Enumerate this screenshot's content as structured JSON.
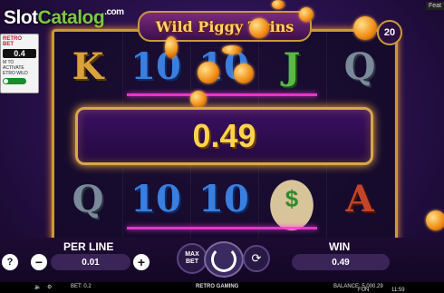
{
  "watermark": {
    "slot": "Slot",
    "catalog": "Catalog",
    "com": ".com"
  },
  "game_title": "Wild Piggy Twins",
  "feature_tab": "Feat",
  "lines": "20",
  "retro_panel": {
    "logo_line1": "RETRO",
    "logo_line2": "BET",
    "value": "0.4",
    "text": "M TO ACTIVATE ETRO WILD"
  },
  "reels": [
    [
      "K",
      "",
      "Q"
    ],
    [
      "10",
      "",
      "10"
    ],
    [
      "10",
      "",
      "10"
    ],
    [
      "J",
      "",
      "$"
    ],
    [
      "Q",
      "",
      "A"
    ]
  ],
  "win_display": "0.49",
  "controls": {
    "help": "?",
    "per_line_label": "PER LINE",
    "per_line_value": "0.01",
    "minus": "−",
    "plus": "+",
    "max_bet": "MAX BET",
    "win_label": "WIN",
    "win_value": "0.49"
  },
  "status_bar": {
    "bet": "BET: 0.2",
    "provider": "RETRO GAMING",
    "balance": "BALANCE: 5,000.29",
    "mode": "FUN",
    "time": "11:59"
  },
  "colors": {
    "accent_gold": "#d6a84a",
    "win_text": "#ffd34a",
    "payline": "#ff3ad8"
  }
}
